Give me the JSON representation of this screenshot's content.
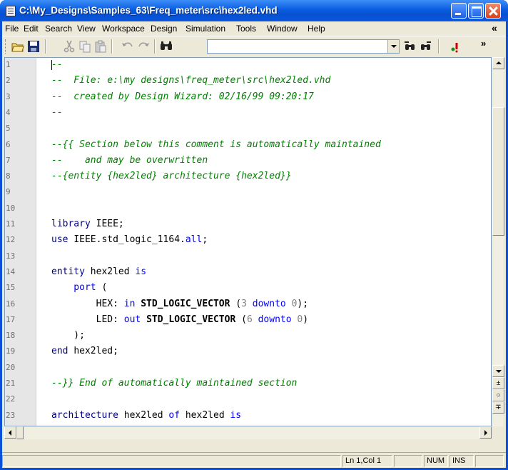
{
  "window": {
    "title": "C:\\My_Designs\\Samples_63\\Freq_meter\\src\\hex2led.vhd"
  },
  "menu": {
    "items": [
      "File",
      "Edit",
      "Search",
      "View",
      "Workspace",
      "Design",
      "Simulation",
      "Tools",
      "Window",
      "Help"
    ],
    "overflow": "«"
  },
  "toolbar": {
    "icons": [
      "open-folder-icon",
      "save-icon",
      "cut-icon",
      "copy-icon",
      "paste-icon",
      "undo-icon",
      "redo-icon",
      "find-icon",
      "find-prev-icon",
      "find-next-icon",
      "bookmark-icon"
    ],
    "overflow": "»",
    "search_value": ""
  },
  "editor": {
    "line_numbers": [
      "1",
      "2",
      "3",
      "4",
      "5",
      "6",
      "7",
      "8",
      "9",
      "10",
      "11",
      "12",
      "13",
      "14",
      "15",
      "16",
      "17",
      "18",
      "19",
      "20",
      "21",
      "22",
      "23"
    ],
    "lines": [
      [
        {
          "t": "--",
          "c": "cmt"
        }
      ],
      [
        {
          "t": "--  File: e:\\my designs\\freq_meter\\src\\hex2led.vhd",
          "c": "cmt"
        }
      ],
      [
        {
          "t": "--  created by Design Wizard: 02/16/99 09:20:17",
          "c": "cmt"
        }
      ],
      [
        {
          "t": "--",
          "c": "cmt"
        }
      ],
      [],
      [
        {
          "t": "--{{ Section below this comment is automatically maintained",
          "c": "cmt"
        }
      ],
      [
        {
          "t": "--    and may be overwritten",
          "c": "cmt"
        }
      ],
      [
        {
          "t": "--{entity {hex2led} architecture {hex2led}}",
          "c": "cmt"
        }
      ],
      [],
      [],
      [
        {
          "t": "library ",
          "c": "id"
        },
        {
          "t": "IEEE;",
          "c": "plain"
        }
      ],
      [
        {
          "t": "use ",
          "c": "id"
        },
        {
          "t": "IEEE.std_logic_1164.",
          "c": "plain"
        },
        {
          "t": "all",
          "c": "kw"
        },
        {
          "t": ";",
          "c": "plain"
        }
      ],
      [],
      [
        {
          "t": "entity ",
          "c": "id"
        },
        {
          "t": "hex2led ",
          "c": "plain"
        },
        {
          "t": "is",
          "c": "kw"
        }
      ],
      [
        {
          "t": "    port ",
          "c": "kw"
        },
        {
          "t": "(",
          "c": "plain"
        }
      ],
      [
        {
          "t": "        HEX: ",
          "c": "plain"
        },
        {
          "t": "in ",
          "c": "kw"
        },
        {
          "t": "STD_LOGIC_VECTOR ",
          "c": "typ"
        },
        {
          "t": "(",
          "c": "plain"
        },
        {
          "t": "3 ",
          "c": "num"
        },
        {
          "t": "downto ",
          "c": "kw"
        },
        {
          "t": "0",
          "c": "num"
        },
        {
          "t": ");",
          "c": "plain"
        }
      ],
      [
        {
          "t": "        LED: ",
          "c": "plain"
        },
        {
          "t": "out ",
          "c": "kw"
        },
        {
          "t": "STD_LOGIC_VECTOR ",
          "c": "typ"
        },
        {
          "t": "(",
          "c": "plain"
        },
        {
          "t": "6 ",
          "c": "num"
        },
        {
          "t": "downto ",
          "c": "kw"
        },
        {
          "t": "0",
          "c": "num"
        },
        {
          "t": ")",
          "c": "plain"
        }
      ],
      [
        {
          "t": "    );",
          "c": "plain"
        }
      ],
      [
        {
          "t": "end ",
          "c": "id"
        },
        {
          "t": "hex2led;",
          "c": "plain"
        }
      ],
      [],
      [
        {
          "t": "--}} End of automatically maintained section",
          "c": "cmt"
        }
      ],
      [],
      [
        {
          "t": "architecture ",
          "c": "id"
        },
        {
          "t": "hex2led ",
          "c": "plain"
        },
        {
          "t": "of ",
          "c": "kw"
        },
        {
          "t": "hex2led ",
          "c": "plain"
        },
        {
          "t": "is",
          "c": "kw"
        }
      ]
    ]
  },
  "scrollbar": {
    "glyphs": [
      "±",
      "○",
      "∓"
    ]
  },
  "status": {
    "position": "Ln 1,Col 1",
    "num": "NUM",
    "ins": "INS"
  },
  "colors": {
    "comment": "#008000",
    "keyword": "#0000ff",
    "identifier": "#000080",
    "number": "#808080",
    "titlebar": "#0a5de0"
  }
}
